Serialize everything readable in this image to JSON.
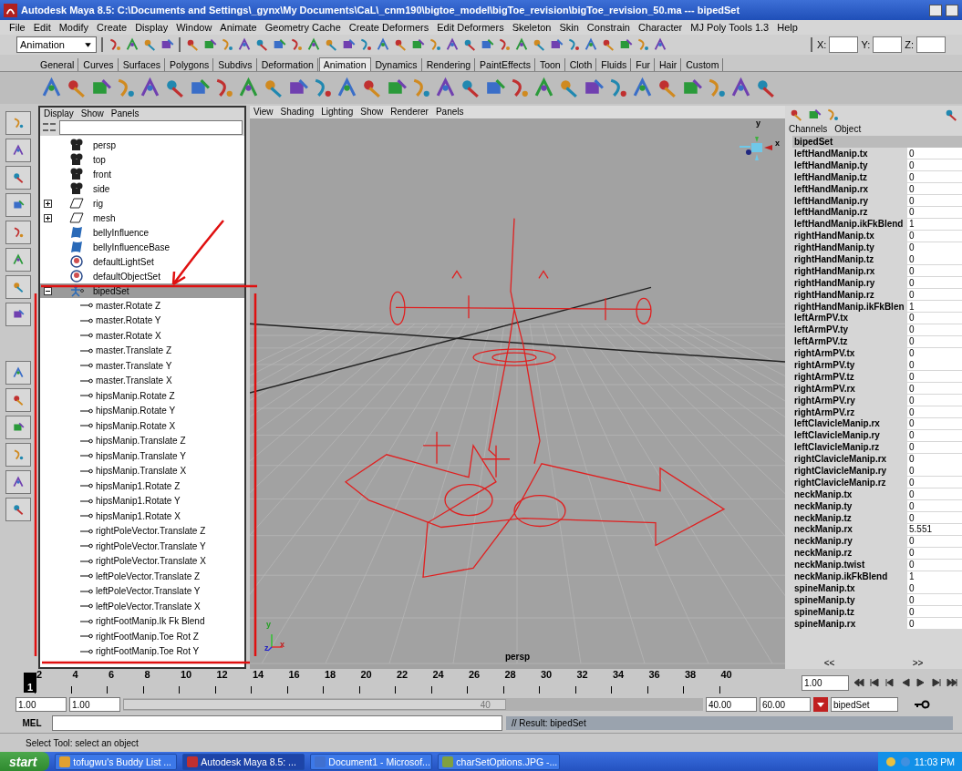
{
  "window": {
    "title": "Autodesk Maya 8.5: C:\\Documents and Settings\\_gynx\\My Documents\\CaL\\_cnm190\\bigtoe_model\\bigToe_revision\\bigToe_revision_50.ma  ---  bipedSet"
  },
  "menus": [
    "File",
    "Edit",
    "Modify",
    "Create",
    "Display",
    "Window",
    "Animate",
    "Geometry Cache",
    "Create Deformers",
    "Edit Deformers",
    "Skeleton",
    "Skin",
    "Constrain",
    "Character",
    "MJ Poly Tools 1.3",
    "Help"
  ],
  "status_line": {
    "mode": "Animation",
    "coord_labels": [
      "X:",
      "Y:",
      "Z:"
    ]
  },
  "shelf_tabs": [
    {
      "label": "General",
      "selected": false
    },
    {
      "label": "Curves",
      "selected": false
    },
    {
      "label": "Surfaces",
      "selected": false
    },
    {
      "label": "Polygons",
      "selected": false
    },
    {
      "label": "Subdivs",
      "selected": false
    },
    {
      "label": "Deformation",
      "selected": false
    },
    {
      "label": "Animation",
      "selected": true
    },
    {
      "label": "Dynamics",
      "selected": false
    },
    {
      "label": "Rendering",
      "selected": false
    },
    {
      "label": "PaintEffects",
      "selected": false
    },
    {
      "label": "Toon",
      "selected": false
    },
    {
      "label": "Cloth",
      "selected": false
    },
    {
      "label": "Fluids",
      "selected": false
    },
    {
      "label": "Fur",
      "selected": false
    },
    {
      "label": "Hair",
      "selected": false
    },
    {
      "label": "Custom",
      "selected": false
    }
  ],
  "outliner": {
    "menus": [
      "Display",
      "Show",
      "Panels"
    ],
    "items": [
      {
        "label": "persp",
        "kind": "camera",
        "selected": false
      },
      {
        "label": "top",
        "kind": "camera",
        "selected": false
      },
      {
        "label": "front",
        "kind": "camera",
        "selected": false
      },
      {
        "label": "side",
        "kind": "camera",
        "selected": false
      },
      {
        "label": "rig",
        "kind": "group",
        "expanded": false,
        "selected": false
      },
      {
        "label": "mesh",
        "kind": "group",
        "expanded": false,
        "selected": false
      },
      {
        "label": "bellyInfluence",
        "kind": "influence",
        "selected": false
      },
      {
        "label": "bellyInfluenceBase",
        "kind": "influence",
        "selected": false
      },
      {
        "label": "defaultLightSet",
        "kind": "set",
        "selected": false
      },
      {
        "label": "defaultObjectSet",
        "kind": "set",
        "selected": false
      },
      {
        "label": "bipedSet",
        "kind": "character",
        "expanded": true,
        "selected": true,
        "children": [
          {
            "label": "master.Rotate Z"
          },
          {
            "label": "master.Rotate Y"
          },
          {
            "label": "master.Rotate X"
          },
          {
            "label": "master.Translate Z"
          },
          {
            "label": "master.Translate Y"
          },
          {
            "label": "master.Translate X"
          },
          {
            "label": "hipsManip.Rotate Z"
          },
          {
            "label": "hipsManip.Rotate Y"
          },
          {
            "label": "hipsManip.Rotate X"
          },
          {
            "label": "hipsManip.Translate Z"
          },
          {
            "label": "hipsManip.Translate Y"
          },
          {
            "label": "hipsManip.Translate X"
          },
          {
            "label": "hipsManip1.Rotate Z"
          },
          {
            "label": "hipsManip1.Rotate Y"
          },
          {
            "label": "hipsManip1.Rotate X"
          },
          {
            "label": "rightPoleVector.Translate Z"
          },
          {
            "label": "rightPoleVector.Translate Y"
          },
          {
            "label": "rightPoleVector.Translate X"
          },
          {
            "label": "leftPoleVector.Translate Z"
          },
          {
            "label": "leftPoleVector.Translate Y"
          },
          {
            "label": "leftPoleVector.Translate X"
          },
          {
            "label": "rightFootManip.Ik Fk Blend"
          },
          {
            "label": "rightFootManip.Toe Rot Z"
          },
          {
            "label": "rightFootManip.Toe Rot Y"
          }
        ]
      }
    ]
  },
  "viewport": {
    "menus": [
      "View",
      "Shading",
      "Lighting",
      "Show",
      "Renderer",
      "Panels"
    ],
    "compass_labels": [
      "y",
      "x"
    ],
    "axis_labels": [
      "y",
      "z",
      "x"
    ],
    "camera": "persp"
  },
  "channel_box": {
    "tabs": [
      "Channels",
      "Object"
    ],
    "node": "bipedSet",
    "scroll_labels": [
      "<<",
      ">>"
    ],
    "channels": [
      {
        "name": "leftHandManip.tx",
        "value": "0"
      },
      {
        "name": "leftHandManip.ty",
        "value": "0"
      },
      {
        "name": "leftHandManip.tz",
        "value": "0"
      },
      {
        "name": "leftHandManip.rx",
        "value": "0"
      },
      {
        "name": "leftHandManip.ry",
        "value": "0"
      },
      {
        "name": "leftHandManip.rz",
        "value": "0"
      },
      {
        "name": "leftHandManip.ikFkBlend",
        "value": "1"
      },
      {
        "name": "rightHandManip.tx",
        "value": "0"
      },
      {
        "name": "rightHandManip.ty",
        "value": "0"
      },
      {
        "name": "rightHandManip.tz",
        "value": "0"
      },
      {
        "name": "rightHandManip.rx",
        "value": "0"
      },
      {
        "name": "rightHandManip.ry",
        "value": "0"
      },
      {
        "name": "rightHandManip.rz",
        "value": "0"
      },
      {
        "name": "rightHandManip.ikFkBlen",
        "value": "1"
      },
      {
        "name": "leftArmPV.tx",
        "value": "0"
      },
      {
        "name": "leftArmPV.ty",
        "value": "0"
      },
      {
        "name": "leftArmPV.tz",
        "value": "0"
      },
      {
        "name": "rightArmPV.tx",
        "value": "0"
      },
      {
        "name": "rightArmPV.ty",
        "value": "0"
      },
      {
        "name": "rightArmPV.tz",
        "value": "0"
      },
      {
        "name": "rightArmPV.rx",
        "value": "0"
      },
      {
        "name": "rightArmPV.ry",
        "value": "0"
      },
      {
        "name": "rightArmPV.rz",
        "value": "0"
      },
      {
        "name": "leftClavicleManip.rx",
        "value": "0"
      },
      {
        "name": "leftClavicleManip.ry",
        "value": "0"
      },
      {
        "name": "leftClavicleManip.rz",
        "value": "0"
      },
      {
        "name": "rightClavicleManip.rx",
        "value": "0"
      },
      {
        "name": "rightClavicleManip.ry",
        "value": "0"
      },
      {
        "name": "rightClavicleManip.rz",
        "value": "0"
      },
      {
        "name": "neckManip.tx",
        "value": "0"
      },
      {
        "name": "neckManip.ty",
        "value": "0"
      },
      {
        "name": "neckManip.tz",
        "value": "0"
      },
      {
        "name": "neckManip.rx",
        "value": "5.551"
      },
      {
        "name": "neckManip.ry",
        "value": "0"
      },
      {
        "name": "neckManip.rz",
        "value": "0"
      },
      {
        "name": "neckManip.twist",
        "value": "0"
      },
      {
        "name": "neckManip.ikFkBlend",
        "value": "1"
      },
      {
        "name": "spineManip.tx",
        "value": "0"
      },
      {
        "name": "spineManip.ty",
        "value": "0"
      },
      {
        "name": "spineManip.tz",
        "value": "0"
      },
      {
        "name": "spineManip.rx",
        "value": "0"
      }
    ]
  },
  "time_slider": {
    "level": 0,
    "current_frame": "1",
    "frame_labels": [
      "2",
      "4",
      "6",
      "8",
      "10",
      "12",
      "14",
      "16",
      "18",
      "20",
      "22",
      "24",
      "26",
      "28",
      "30",
      "32",
      "34",
      "36",
      "38",
      "40"
    ],
    "current_time": "1.00"
  },
  "range_slider": {
    "level": 0.66,
    "start_time": "1.00",
    "playback_start": "1.00",
    "range_label": "40",
    "playback_end": "40.00",
    "end_time": "60.00",
    "character_set": "bipedSet"
  },
  "command_line": {
    "label": "MEL",
    "result": "// Result: bipedSet"
  },
  "help_line": "Select Tool: select an object",
  "taskbar": {
    "start": "start",
    "tasks": [
      {
        "label": "tofugwu's Buddy List ...",
        "selected": false
      },
      {
        "label": "Autodesk Maya 8.5: ...",
        "selected": true
      },
      {
        "label": "Document1 - Microsof...",
        "selected": false
      },
      {
        "label": "charSetOptions.JPG -...",
        "selected": false
      }
    ],
    "clock": "11:03 PM"
  }
}
